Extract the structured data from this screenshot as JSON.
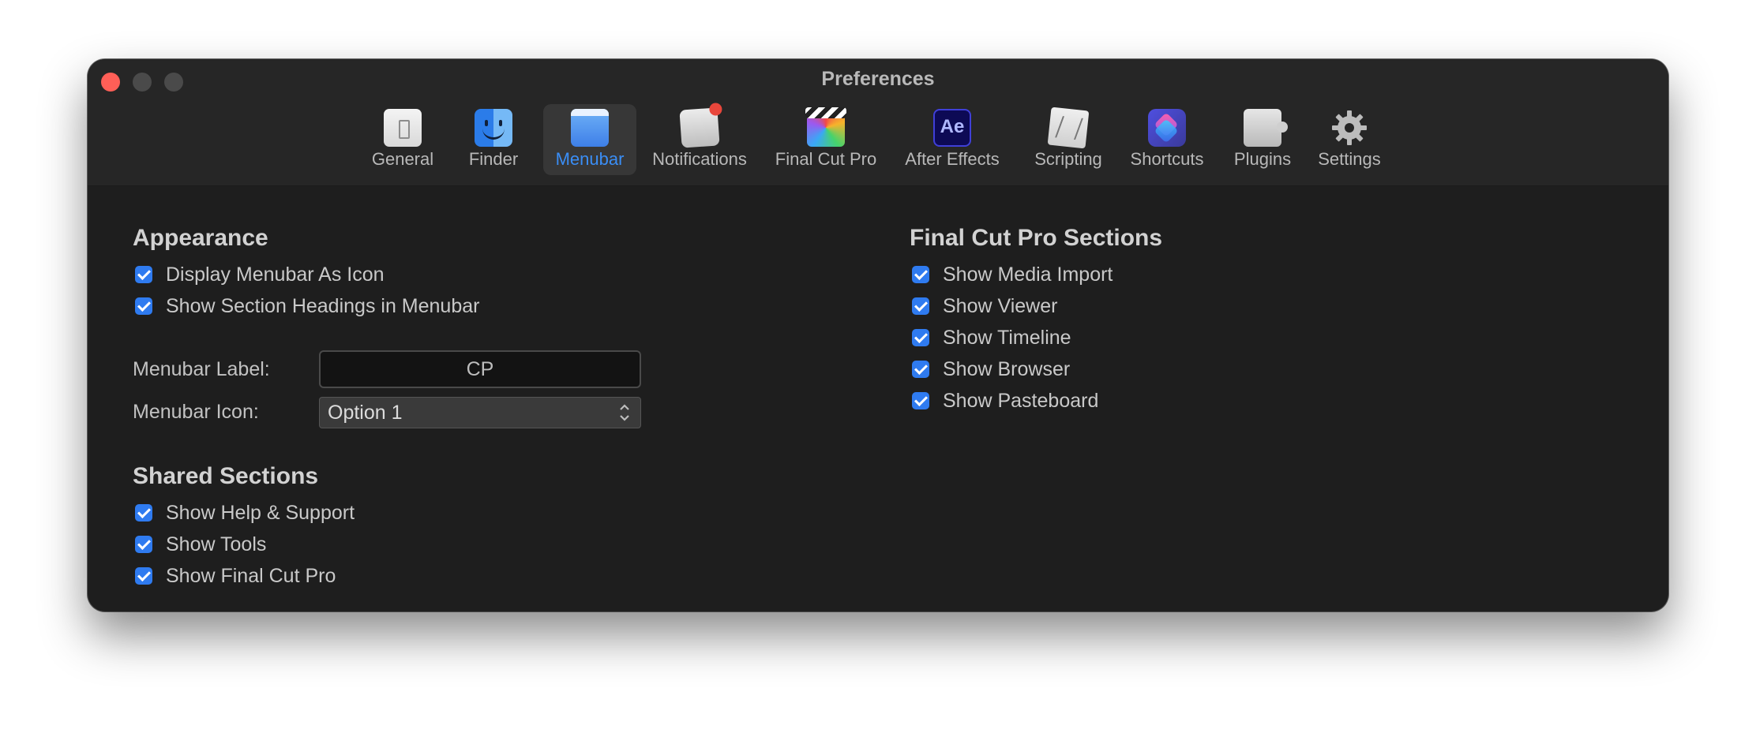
{
  "window": {
    "title": "Preferences"
  },
  "toolbar": {
    "items": [
      {
        "label": "General",
        "icon": "general-icon"
      },
      {
        "label": "Finder",
        "icon": "finder-icon"
      },
      {
        "label": "Menubar",
        "icon": "menubar-icon",
        "selected": true
      },
      {
        "label": "Notifications",
        "icon": "notifications-icon"
      },
      {
        "label": "Final Cut Pro",
        "icon": "final-cut-pro-icon"
      },
      {
        "label": "After Effects",
        "icon": "after-effects-icon",
        "glyph": "Ae"
      },
      {
        "label": "Scripting",
        "icon": "scripting-icon"
      },
      {
        "label": "Shortcuts",
        "icon": "shortcuts-icon"
      },
      {
        "label": "Plugins",
        "icon": "plugins-icon"
      },
      {
        "label": "Settings",
        "icon": "gear-icon"
      }
    ]
  },
  "appearance": {
    "title": "Appearance",
    "options": [
      {
        "label": "Display Menubar As Icon",
        "checked": true
      },
      {
        "label": "Show Section Headings in Menubar",
        "checked": true
      }
    ],
    "menubar_label": {
      "label": "Menubar Label:",
      "value": "CP"
    },
    "menubar_icon": {
      "label": "Menubar Icon:",
      "value": "Option 1"
    }
  },
  "shared_sections": {
    "title": "Shared Sections",
    "options": [
      {
        "label": "Show Help & Support",
        "checked": true
      },
      {
        "label": "Show Tools",
        "checked": true
      },
      {
        "label": "Show Final Cut Pro",
        "checked": true
      }
    ]
  },
  "fcp_sections": {
    "title": "Final Cut Pro Sections",
    "options": [
      {
        "label": "Show Media Import",
        "checked": true
      },
      {
        "label": "Show Viewer",
        "checked": true
      },
      {
        "label": "Show Timeline",
        "checked": true
      },
      {
        "label": "Show Browser",
        "checked": true
      },
      {
        "label": "Show Pasteboard",
        "checked": true
      }
    ]
  },
  "colors": {
    "accent": "#2f7bf0",
    "selected_label": "#3a8ef6",
    "window_bg": "#1e1e1e",
    "close_button": "#ff5f57"
  }
}
